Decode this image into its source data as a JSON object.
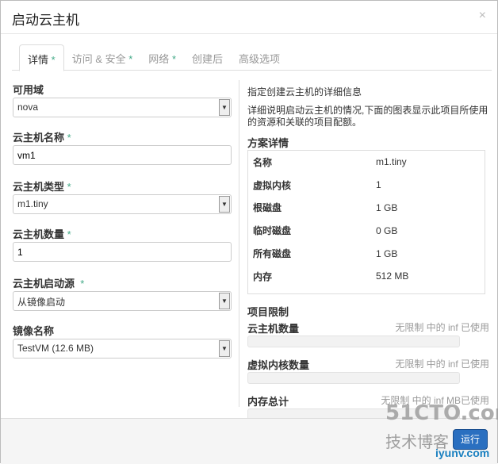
{
  "title": "启动云主机",
  "close": "×",
  "tabs": [
    {
      "label": "详情",
      "star": "*"
    },
    {
      "label": "访问 & 安全",
      "star": "*"
    },
    {
      "label": "网络",
      "star": "*"
    },
    {
      "label": "创建后",
      "star": ""
    },
    {
      "label": "高级选项",
      "star": ""
    }
  ],
  "form": {
    "zone": {
      "label": "可用域",
      "value": "nova"
    },
    "name": {
      "label": "云主机名称",
      "value": "vm1"
    },
    "flavor": {
      "label": "云主机类型",
      "value": "m1.tiny"
    },
    "count": {
      "label": "云主机数量",
      "value": "1"
    },
    "source": {
      "label": "云主机启动源",
      "value": "从镜像启动"
    },
    "image": {
      "label": "镜像名称",
      "value": "TestVM (12.6 MB)"
    },
    "req": "*"
  },
  "info": {
    "title": "指定创建云主机的详细信息",
    "desc": "详细说明启动云主机的情况,下面的图表显示此项目所使用的资源和关联的项目配额。"
  },
  "flavor_details": {
    "title": "方案详情",
    "rows": [
      [
        "名称",
        "m1.tiny"
      ],
      [
        "虚拟内核",
        "1"
      ],
      [
        "根磁盘",
        "1 GB"
      ],
      [
        "临时磁盘",
        "0 GB"
      ],
      [
        "所有磁盘",
        "1 GB"
      ],
      [
        "内存",
        "512 MB"
      ]
    ]
  },
  "limits": {
    "title": "项目限制",
    "items": [
      {
        "label": "云主机数量",
        "value": "无限制 中的 inf 已使用",
        "fraction": 0
      },
      {
        "label": "虚拟内核数量",
        "value": "无限制 中的 inf 已使用",
        "fraction": 0
      },
      {
        "label": "内存总计",
        "value": "无限制 中的 inf MB已使用",
        "fraction": 0
      }
    ]
  },
  "footer": {
    "launch": "运行"
  },
  "watermark": {
    "line1": "51CTO.com",
    "line2": "技术博客",
    "line3": "iyunv.com"
  }
}
